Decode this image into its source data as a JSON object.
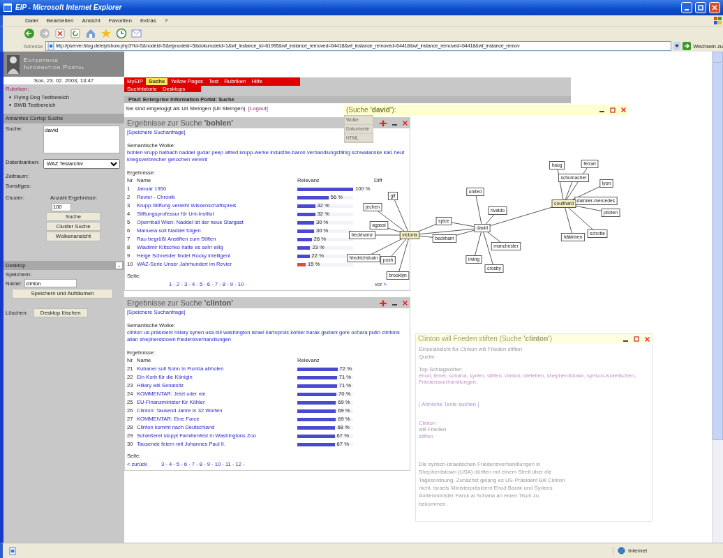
{
  "window": {
    "title": "EIP - Microsoft Internet Explorer"
  },
  "menu": [
    "Datei",
    "Bearbeiten",
    "Ansicht",
    "Favoriten",
    "Extras",
    "?"
  ],
  "address": {
    "label": "Adresse",
    "url": "http://pserver.fdog.de/eip/show.php3?id=5&nodeid=5&eipnodeid=5&dokunodeid=1&wf_instance_id=61995&wf_instance_removed=64418&wf_instance_removed=64418&wf_instance_removed=64418&wf_instance_remov",
    "go": "Wechseln zu"
  },
  "sidebar": {
    "logo": [
      "Enterprise",
      "Information Portal"
    ],
    "date": "Son, 23. 02. 2003, 13:47",
    "rubriken_label": "Rubriken:",
    "rubriken": [
      "Flying Dog Testbereich",
      "BWB Testbereich"
    ],
    "search": {
      "title": "Amanites Cortop Suche",
      "query_label": "Suche:",
      "query": "david",
      "db_label": "Datenbanken:",
      "db": "WAZ Testarchiv",
      "period_label": "Zeitraum:",
      "other_label": "Sonstiges:",
      "cluster_label": "Cluster:",
      "count_label": "Anzahl Ergebnisse:",
      "count": "100",
      "buttons": [
        "Suche",
        "Cluster Suche",
        "Wolkenansicht"
      ]
    },
    "desktop": {
      "title": "Desktop",
      "collapse": "-",
      "save_label": "Speichern:",
      "name_label": "Name:",
      "name": "clinton",
      "save_button": "Speichern und Aufräumen",
      "delete_label": "Löschen:",
      "delete_button": "Desktop löschen"
    }
  },
  "nav": {
    "tabs": [
      {
        "label": "MyEIP",
        "selected": false
      },
      {
        "label": "Suche",
        "selected": true
      },
      {
        "label": "Yellow Pages",
        "selected": false
      },
      {
        "label": "Test",
        "selected": false
      },
      {
        "label": "Rubriken",
        "selected": false
      },
      {
        "label": "Hilfe",
        "selected": false
      }
    ],
    "subtabs": [
      "Suchhistorie",
      "Desktops"
    ],
    "path": "Pfad:  Enterprise Information Portal: Suche",
    "login": "Sie sind eingeloggt als Uli Steingen (Uli Steingen)",
    "logout": "[Logout]"
  },
  "panels": [
    {
      "title": "Ergebnisse zur Suche **'bohlen'**",
      "save_link": "[Speichere Suchanfrage]",
      "cloud_label": "Semantische Wolke:",
      "cloud": "bohlen krupp halbach naddel gudar peep alfred krupp-werke industrie-baron verhandlungsfähig schwalanske kaß heut kriegsverbrecher gerochen vereint",
      "results_label": "Ergebnisse:",
      "columns": [
        "Nr.",
        "Name",
        "Relevanz",
        "Diff"
      ],
      "rows": [
        {
          "nr": "1",
          "name": "Januar 1950",
          "level": 1.0,
          "percent": "100 %",
          "color": "#4a4ad0"
        },
        {
          "nr": "2",
          "name": "Revier - Chronik",
          "level": 0.56,
          "percent": "56 %",
          "color": "#4a4ad0"
        },
        {
          "nr": "3",
          "name": "Krupp-Stiftung verleiht Wissenschaftspreis",
          "level": 0.32,
          "percent": "32 %",
          "color": "#4a4ad0"
        },
        {
          "nr": "4",
          "name": "Stiftungsprofessur für Uni-Institut",
          "level": 0.32,
          "percent": "32 %",
          "color": "#4a4ad0"
        },
        {
          "nr": "5",
          "name": "Opernball Wien: Naddel ist der neue Stargast",
          "level": 0.3,
          "percent": "30 %",
          "color": "#4a4ad0"
        },
        {
          "nr": "6",
          "name": "Manuela soll Naddel folgen",
          "level": 0.3,
          "percent": "30 %",
          "color": "#4a4ad0"
        },
        {
          "nr": "7",
          "name": "Rau begrüßt Anstiften zum Stiften",
          "level": 0.26,
          "percent": "26 %",
          "color": "#4a4ad0"
        },
        {
          "nr": "8",
          "name": "Wladimir Klitschko hatte es sehr eilig",
          "level": 0.23,
          "percent": "23 %",
          "color": "#4a4ad0"
        },
        {
          "nr": "9",
          "name": "Helge Schneider findet Rocky intelligent",
          "level": 0.22,
          "percent": "22 %",
          "color": "#4a4ad0"
        },
        {
          "nr": "10",
          "name": "WAZ-Serie Unser Jahrhundert im Revier",
          "level": 0.15,
          "percent": "15 %",
          "color": "#e04848"
        }
      ],
      "page_label": "Seite:",
      "pages": "1 - 2 - 3 - 4 - 5 - 6 - 7 - 8 - 9 - 10 -",
      "next": "vor >"
    },
    {
      "title": "Ergebnisse zur Suche **'clinton'**",
      "save_link": "[Speichere Suchanfrage]",
      "cloud_label": "Semantische Wolke:",
      "cloud": "clinton us-präsident hillary syrien usa bill washington israel kartoprois köhler barak giuliani gore ochara putin clintons allan shepherdstown friedensverhandlungen",
      "results_label": "Ergebnisse:",
      "columns": [
        "Nr.",
        "Name",
        "Relevanz"
      ],
      "rows": [
        {
          "nr": "21",
          "name": "Kubaner soll Sohn in Florida abholen",
          "level": 0.72,
          "percent": "72 %",
          "color": "#4a4ad0"
        },
        {
          "nr": "22",
          "name": "Ein Korb für die Königin",
          "level": 0.71,
          "percent": "71 %",
          "color": "#4a4ad0"
        },
        {
          "nr": "23",
          "name": "Hillary will Senatsitz",
          "level": 0.71,
          "percent": "71 %",
          "color": "#4a4ad0"
        },
        {
          "nr": "24",
          "name": "KOMMENTAR: Jetzt oder nie",
          "level": 0.7,
          "percent": "70 %",
          "color": "#4a4ad0"
        },
        {
          "nr": "25",
          "name": "EU-Finanzminister für Köhler",
          "level": 0.69,
          "percent": "69 %",
          "color": "#4a4ad0"
        },
        {
          "nr": "26",
          "name": "Clinton: Tausend Jahre in 32 Worten",
          "level": 0.69,
          "percent": "69 %",
          "color": "#4a4ad0"
        },
        {
          "nr": "27",
          "name": "KOMMENTAR: Eine Farce",
          "level": 0.69,
          "percent": "69 %",
          "color": "#4a4ad0"
        },
        {
          "nr": "28",
          "name": "Clinton kommt nach Deutschland",
          "level": 0.68,
          "percent": "68 %",
          "color": "#4a4ad0"
        },
        {
          "nr": "29",
          "name": "Schießerei stoppt Familienfest in Washingtons Zoo",
          "level": 0.67,
          "percent": "67 %",
          "color": "#4a4ad0"
        },
        {
          "nr": "30",
          "name": "Tausende feiern mit Johannes Paul II.",
          "level": 0.67,
          "percent": "67 %",
          "color": "#4a4ad0"
        }
      ],
      "page_label": "Seite:",
      "back": "< zurück",
      "pages": "3 - 4 - 5 - 6 - 7 - 8 - 9 - 10 - 11 - 12 -"
    }
  ],
  "graph_window": {
    "title": "(Suche **'david'**):",
    "menu": [
      "Wolke",
      "Dokumente",
      "HTML"
    ],
    "nodes": [
      {
        "label": "ferrari",
        "highlighted": false
      },
      {
        "label": "haug",
        "highlighted": false
      },
      {
        "label": "schumacher",
        "highlighted": false
      },
      {
        "label": "lyon",
        "highlighted": false
      },
      {
        "label": "united",
        "highlighted": false
      },
      {
        "label": "gif",
        "highlighted": false
      },
      {
        "label": "daimler-mercedes",
        "highlighted": false
      },
      {
        "label": "coulthard",
        "highlighted": true
      },
      {
        "label": "jechen",
        "highlighted": false
      },
      {
        "label": "rivaldo",
        "highlighted": false
      },
      {
        "label": "piloten",
        "highlighted": false
      },
      {
        "label": "spice",
        "highlighted": false
      },
      {
        "label": "agassi",
        "highlighted": false
      },
      {
        "label": "david",
        "highlighted": false
      },
      {
        "label": "schotte",
        "highlighted": false
      },
      {
        "label": "beckhamz",
        "highlighted": false
      },
      {
        "label": "victoria",
        "highlighted": true
      },
      {
        "label": "häkkinen",
        "highlighted": false
      },
      {
        "label": "beckham",
        "highlighted": false
      },
      {
        "label": "manchester",
        "highlighted": false
      },
      {
        "label": "friedrichshain",
        "highlighted": false
      },
      {
        "label": "posh",
        "highlighted": false
      },
      {
        "label": "irving",
        "highlighted": false
      },
      {
        "label": "crosby",
        "highlighted": false
      },
      {
        "label": "brooklyn",
        "highlighted": false
      }
    ]
  },
  "detail_window": {
    "title": "Clinton will Frieden stiften (Suche **'clinton'**)",
    "heading": "Einzelansicht für Clinton will Frieden stiften",
    "source": "Quelle:",
    "keywords_label": "Top-Schlagwörter:",
    "keywords": "ehud, tenet, scharia, syrien, stiften, clinton, diefelten, shepherdstown, syrisch-israelischen, Friedensverhandlungen,",
    "similar": "[ Ähnliche Texte suchen ]",
    "headline": [
      "Clinton",
      "will Frieden",
      "stiften"
    ],
    "body": "Die syrisch-israelischen Friedensverhandlungen in Shepherdstown (USA) dürften mit einem Streit über die Tagesordnung. Zunächst gelang es US-Präsident Bill Clinton nicht, Israels Ministerpräsident Ehud Barak und Syriens Außenminister Faruk al Scharia an einen Tisch zu bekommen."
  },
  "status_bar": {
    "zone": "Internet"
  }
}
